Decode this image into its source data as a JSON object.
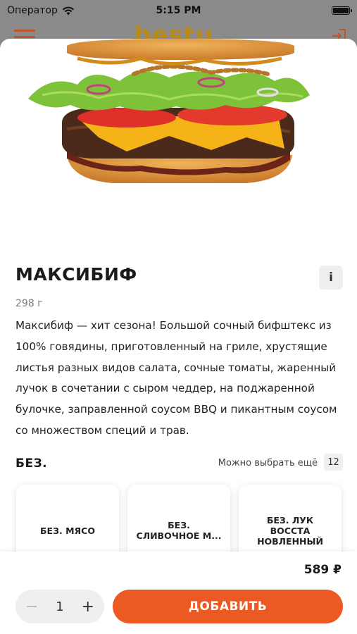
{
  "status_bar": {
    "carrier": "Оператор",
    "time": "5:15 PM"
  },
  "header": {
    "logo": "bestu"
  },
  "product": {
    "title": "МАКСИБИФ",
    "info_label": "i",
    "weight": "298 г",
    "description": "Максибиф — хит сезона! Большой сочный бифштекс из 100% говядины, приготовленный на гриле, хрустящие листья разных видов салата, сочные томаты, жаренный лучок в сочетании с сыром чеддер,  на поджаренной булочке, заправленной соусом BBQ и пикантным соусом со множеством специй и трав."
  },
  "modifiers": {
    "title": "БЕЗ.",
    "choose_more": "Можно выбрать ещё",
    "count": "12",
    "options": [
      "БЕЗ. МЯСО",
      "БЕЗ.\nСЛИВОЧНОЕ М...",
      "БЕЗ. ЛУК ВОССТА\nНОВЛЕННЫЙ"
    ]
  },
  "bottom_bar": {
    "price": "589 ₽",
    "quantity": "1",
    "minus": "−",
    "plus": "+",
    "add_label": "ДОБАВИТЬ"
  },
  "colors": {
    "accent": "#ec5a24",
    "logo": "#b88a1a"
  },
  "icons": [
    "wifi-icon",
    "battery-icon",
    "hamburger-menu-icon",
    "login-icon",
    "info-icon"
  ]
}
